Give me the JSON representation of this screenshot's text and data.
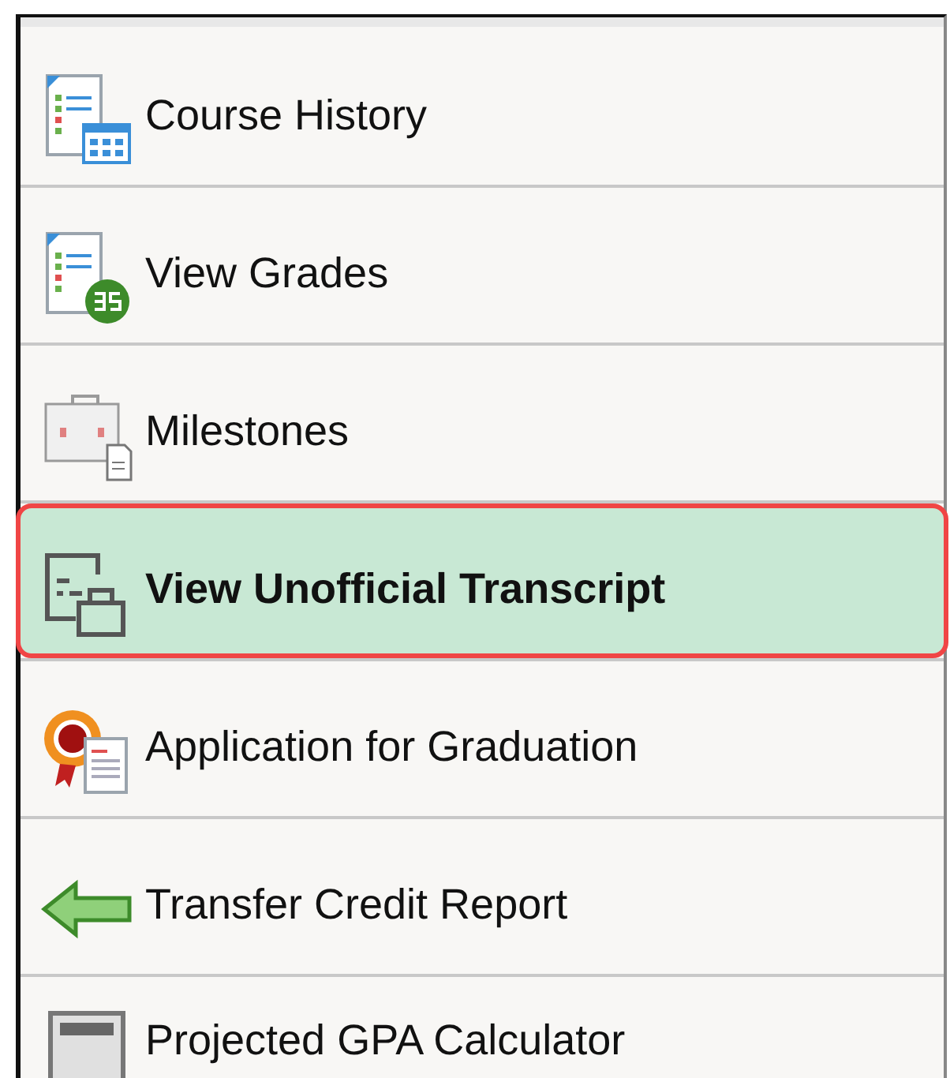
{
  "menu": {
    "items": [
      {
        "label": "Course History",
        "selected": false
      },
      {
        "label": "View Grades",
        "selected": false
      },
      {
        "label": "Milestones",
        "selected": false
      },
      {
        "label": "View Unofficial Transcript",
        "selected": true
      },
      {
        "label": "Application for Graduation",
        "selected": false
      },
      {
        "label": "Transfer Credit Report",
        "selected": false
      },
      {
        "label": "Projected GPA Calculator",
        "selected": false
      }
    ]
  }
}
